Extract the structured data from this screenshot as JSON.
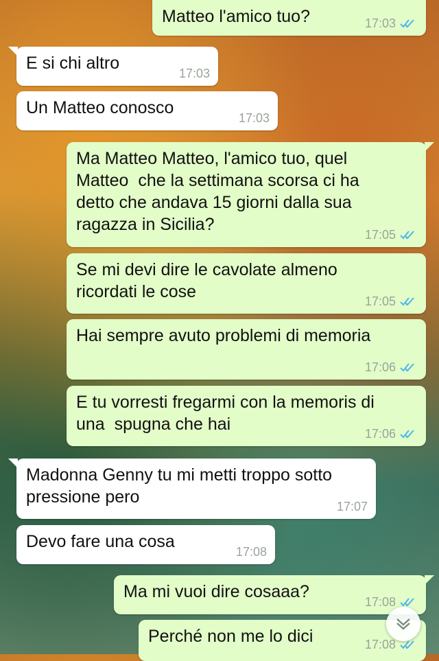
{
  "messages": [
    {
      "side": "out",
      "text": "Matteo l'amico tuo?",
      "time": "17:03",
      "read": true
    },
    {
      "side": "in",
      "text": "E si chi altro",
      "time": "17:03"
    },
    {
      "side": "in",
      "text": "Un Matteo conosco",
      "time": "17:03"
    },
    {
      "side": "out",
      "text": "Ma Matteo Matteo, l'amico tuo, quel\nMatteo  che la settimana scorsa ci ha\ndetto che andava 15 giorni dalla sua\nragazza in Sicilia?",
      "time": "17:05",
      "read": true
    },
    {
      "side": "out",
      "text": "Se mi devi dire le cavolate almeno\nricordati le cose",
      "time": "17:05",
      "read": true
    },
    {
      "side": "out",
      "text": "Hai sempre avuto problemi di memoria",
      "time": "17:06",
      "read": true
    },
    {
      "side": "out",
      "text": "E tu vorresti fregarmi con la memoris di\nuna  spugna che hai",
      "time": "17:06",
      "read": true
    },
    {
      "side": "in",
      "text": "Madonna Genny tu mi metti troppo sotto\npressione pero",
      "time": "17:07"
    },
    {
      "side": "in",
      "text": "Devo fare una cosa",
      "time": "17:08"
    },
    {
      "side": "out",
      "text": "Ma mi vuoi dire cosaaa?",
      "time": "17:08",
      "read": true
    },
    {
      "side": "out",
      "text": "Perché non me lo dici",
      "time": "17:08",
      "read": true
    }
  ],
  "colors": {
    "incoming": "#ffffff",
    "outgoing": "#e2fdc8",
    "read_ticks": "#4fb6ec"
  },
  "icons": {
    "read_receipt": "double-check-icon",
    "scroll_down": "chevron-down-icon"
  }
}
